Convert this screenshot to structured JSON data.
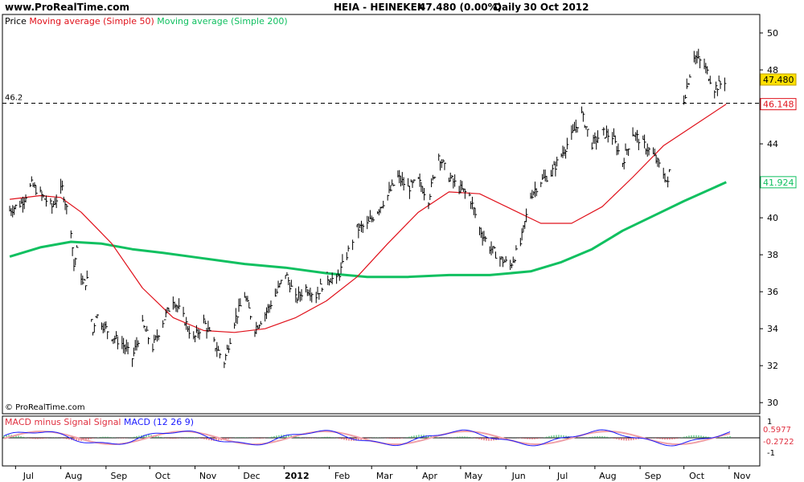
{
  "header": {
    "site": "www.ProRealTime.com",
    "ticker": "HEIA - HEINEKEN",
    "price": "47.480 (0.00%)",
    "period": "Daily",
    "date": "30 Oct 2012"
  },
  "price_panel": {
    "legend_price": "Price",
    "legend_ma50": "Moving average (Simple 50)",
    "legend_ma200": "Moving average (Simple 200)",
    "watermark": "© ProRealTime.com",
    "hline_label": "46.2",
    "tag_last": "47.480",
    "tag_ma50": "46.148",
    "tag_ma200": "41.924"
  },
  "macd_panel": {
    "legend_hist": "MACD minus Signal Signal",
    "legend_macd": "MACD (12 26 9)",
    "tag_macd": "0.5977",
    "tag_signal": "-0.2722",
    "tick_top": "1",
    "tick_bottom": "-1"
  },
  "colors": {
    "price_bars": "#000000",
    "ma50": "#e0101a",
    "ma200": "#10c060",
    "hline": "#000000",
    "tag_last_bg": "#ffe000",
    "macd_line": "#1a1aff",
    "signal_line": "#f0a0a8",
    "hist_pos": "#20b050",
    "hist_neg": "#e03040"
  },
  "chart_data": {
    "type": "line",
    "title": "HEIA - HEINEKEN",
    "xlabel": "",
    "ylabel": "",
    "ylim": [
      29.4,
      51
    ],
    "y_ticks": [
      30,
      32,
      34,
      36,
      38,
      40,
      42,
      44,
      46,
      48,
      50
    ],
    "x_ticks": [
      "Jul",
      "Aug",
      "Sep",
      "Oct",
      "Nov",
      "Dec",
      "2012",
      "Feb",
      "Mar",
      "Apr",
      "May",
      "Jun",
      "Jul",
      "Aug",
      "Sep",
      "Oct",
      "Nov"
    ],
    "grid": false,
    "reference_line": 46.2,
    "series": [
      {
        "name": "Price",
        "style": "ohlc",
        "x": [
          "2011-06-27",
          "2011-07-05",
          "2011-07-12",
          "2011-07-19",
          "2011-07-26",
          "2011-08-02",
          "2011-08-08",
          "2011-08-10",
          "2011-08-12",
          "2011-08-16",
          "2011-08-19",
          "2011-08-23",
          "2011-08-25",
          "2011-08-30",
          "2011-09-05",
          "2011-09-12",
          "2011-09-19",
          "2011-09-26",
          "2011-10-03",
          "2011-10-10",
          "2011-10-17",
          "2011-10-24",
          "2011-10-31",
          "2011-11-07",
          "2011-11-14",
          "2011-11-21",
          "2011-11-28",
          "2011-12-05",
          "2011-12-12",
          "2011-12-19",
          "2011-12-26",
          "2012-01-02",
          "2012-01-09",
          "2012-01-16",
          "2012-01-23",
          "2012-01-30",
          "2012-02-06",
          "2012-02-13",
          "2012-02-20",
          "2012-02-27",
          "2012-03-05",
          "2012-03-12",
          "2012-03-19",
          "2012-03-26",
          "2012-04-02",
          "2012-04-09",
          "2012-04-16",
          "2012-04-23",
          "2012-04-30",
          "2012-05-07",
          "2012-05-14",
          "2012-05-21",
          "2012-05-28",
          "2012-06-04",
          "2012-06-11",
          "2012-06-18",
          "2012-06-25",
          "2012-07-02",
          "2012-07-09",
          "2012-07-16",
          "2012-07-23",
          "2012-07-30",
          "2012-08-06",
          "2012-08-13",
          "2012-08-20",
          "2012-08-27",
          "2012-09-03",
          "2012-09-10",
          "2012-09-17",
          "2012-09-20",
          "2012-09-24",
          "2012-10-01",
          "2012-10-08",
          "2012-10-15",
          "2012-10-22",
          "2012-10-30"
        ],
        "values": [
          40.4,
          40.8,
          41.8,
          41.2,
          40.6,
          41.6,
          39.4,
          37.4,
          38.2,
          36.4,
          36.6,
          33.8,
          34.8,
          34.2,
          33.6,
          33.2,
          32.4,
          34.2,
          33.0,
          34.4,
          35.6,
          34.6,
          33.4,
          34.4,
          33.2,
          32.2,
          34.4,
          35.8,
          34.0,
          34.8,
          35.8,
          37.0,
          35.6,
          36.2,
          35.8,
          36.8,
          36.6,
          38.0,
          39.4,
          39.6,
          40.4,
          41.2,
          42.2,
          41.6,
          42.0,
          41.0,
          43.4,
          42.2,
          41.6,
          41.2,
          39.4,
          38.4,
          37.8,
          37.4,
          38.6,
          41.2,
          42.0,
          42.4,
          43.4,
          44.4,
          45.6,
          44.0,
          44.6,
          44.4,
          43.0,
          44.6,
          44.0,
          43.4,
          42.4,
          41.8,
          44.8,
          46.4,
          48.8,
          48.2,
          47.0,
          47.48
        ]
      },
      {
        "name": "Moving average (Simple 50)",
        "x": [
          "2011-06-27",
          "2011-07-18",
          "2011-08-01",
          "2011-08-15",
          "2011-09-05",
          "2011-09-26",
          "2011-10-17",
          "2011-11-07",
          "2011-11-28",
          "2011-12-19",
          "2012-01-09",
          "2012-01-30",
          "2012-02-20",
          "2012-03-12",
          "2012-04-02",
          "2012-04-23",
          "2012-05-14",
          "2012-06-04",
          "2012-06-25",
          "2012-07-16",
          "2012-08-06",
          "2012-08-27",
          "2012-09-17",
          "2012-10-08",
          "2012-10-30"
        ],
        "values": [
          41.0,
          41.2,
          41.1,
          40.3,
          38.6,
          36.2,
          34.6,
          33.9,
          33.8,
          34.0,
          34.6,
          35.5,
          36.8,
          38.6,
          40.3,
          41.4,
          41.3,
          40.5,
          39.7,
          39.7,
          40.6,
          42.2,
          43.9,
          45.0,
          46.148
        ]
      },
      {
        "name": "Moving average (Simple 200)",
        "x": [
          "2011-06-27",
          "2011-07-18",
          "2011-08-08",
          "2011-08-29",
          "2011-09-19",
          "2011-10-10",
          "2011-11-07",
          "2011-12-05",
          "2012-01-02",
          "2012-01-30",
          "2012-02-27",
          "2012-03-26",
          "2012-04-23",
          "2012-05-21",
          "2012-06-18",
          "2012-07-09",
          "2012-07-30",
          "2012-08-20",
          "2012-09-10",
          "2012-10-01",
          "2012-10-30"
        ],
        "values": [
          37.9,
          38.4,
          38.7,
          38.6,
          38.3,
          38.1,
          37.8,
          37.5,
          37.3,
          37.0,
          36.8,
          36.8,
          36.9,
          36.9,
          37.1,
          37.6,
          38.3,
          39.3,
          40.1,
          40.9,
          41.924
        ]
      }
    ]
  }
}
